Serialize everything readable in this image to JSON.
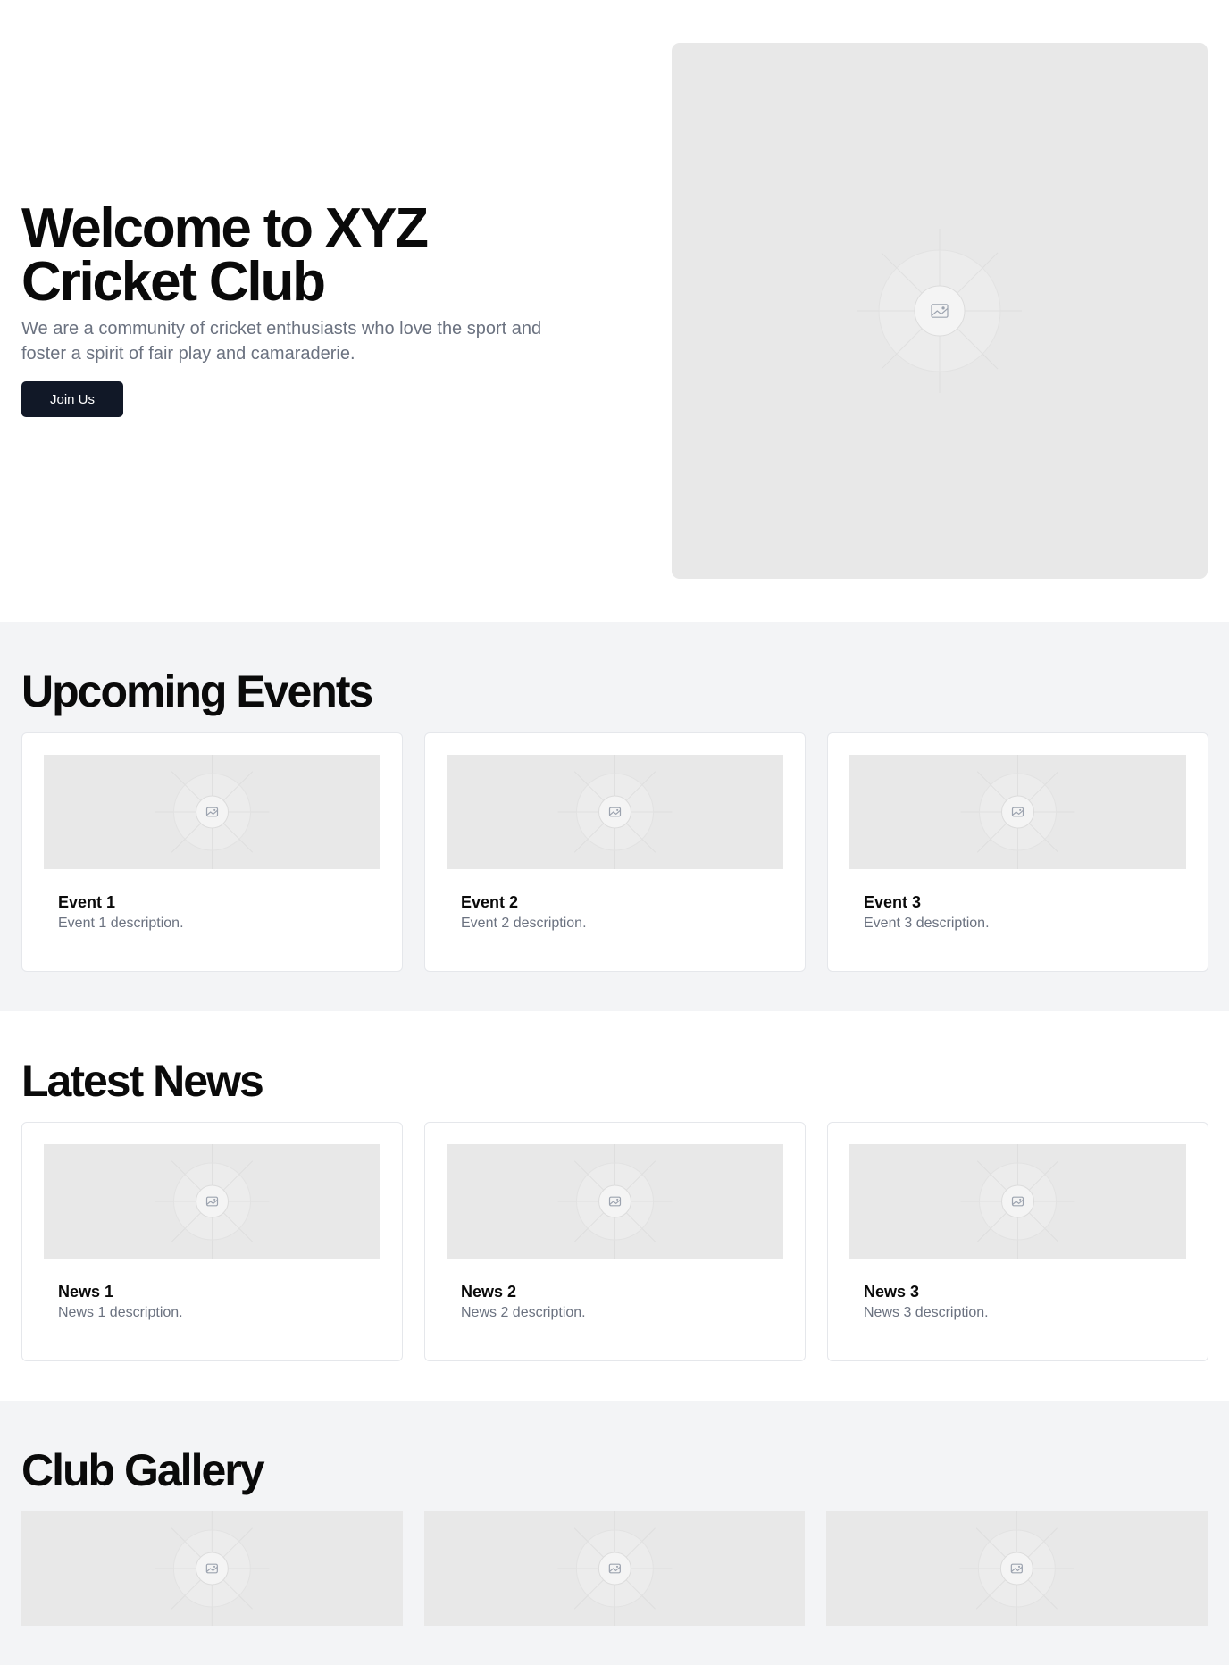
{
  "hero": {
    "title": "Welcome to XYZ Cricket Club",
    "subtitle": "We are a community of cricket enthusiasts who love the sport and foster a spirit of fair play and camaraderie.",
    "cta_label": "Join Us",
    "image_icon": "image-placeholder-icon"
  },
  "events": {
    "title": "Upcoming Events",
    "items": [
      {
        "title": "Event 1",
        "description": "Event 1 description."
      },
      {
        "title": "Event 2",
        "description": "Event 2 description."
      },
      {
        "title": "Event 3",
        "description": "Event 3 description."
      }
    ]
  },
  "news": {
    "title": "Latest News",
    "items": [
      {
        "title": "News 1",
        "description": "News 1 description."
      },
      {
        "title": "News 2",
        "description": "News 2 description."
      },
      {
        "title": "News 3",
        "description": "News 3 description."
      }
    ]
  },
  "gallery": {
    "title": "Club Gallery",
    "image_count": 3
  },
  "colors": {
    "button_bg": "#111827",
    "section_gray": "#f3f4f6",
    "muted_text": "#6b7280",
    "placeholder_bg": "#e8e8e8"
  }
}
